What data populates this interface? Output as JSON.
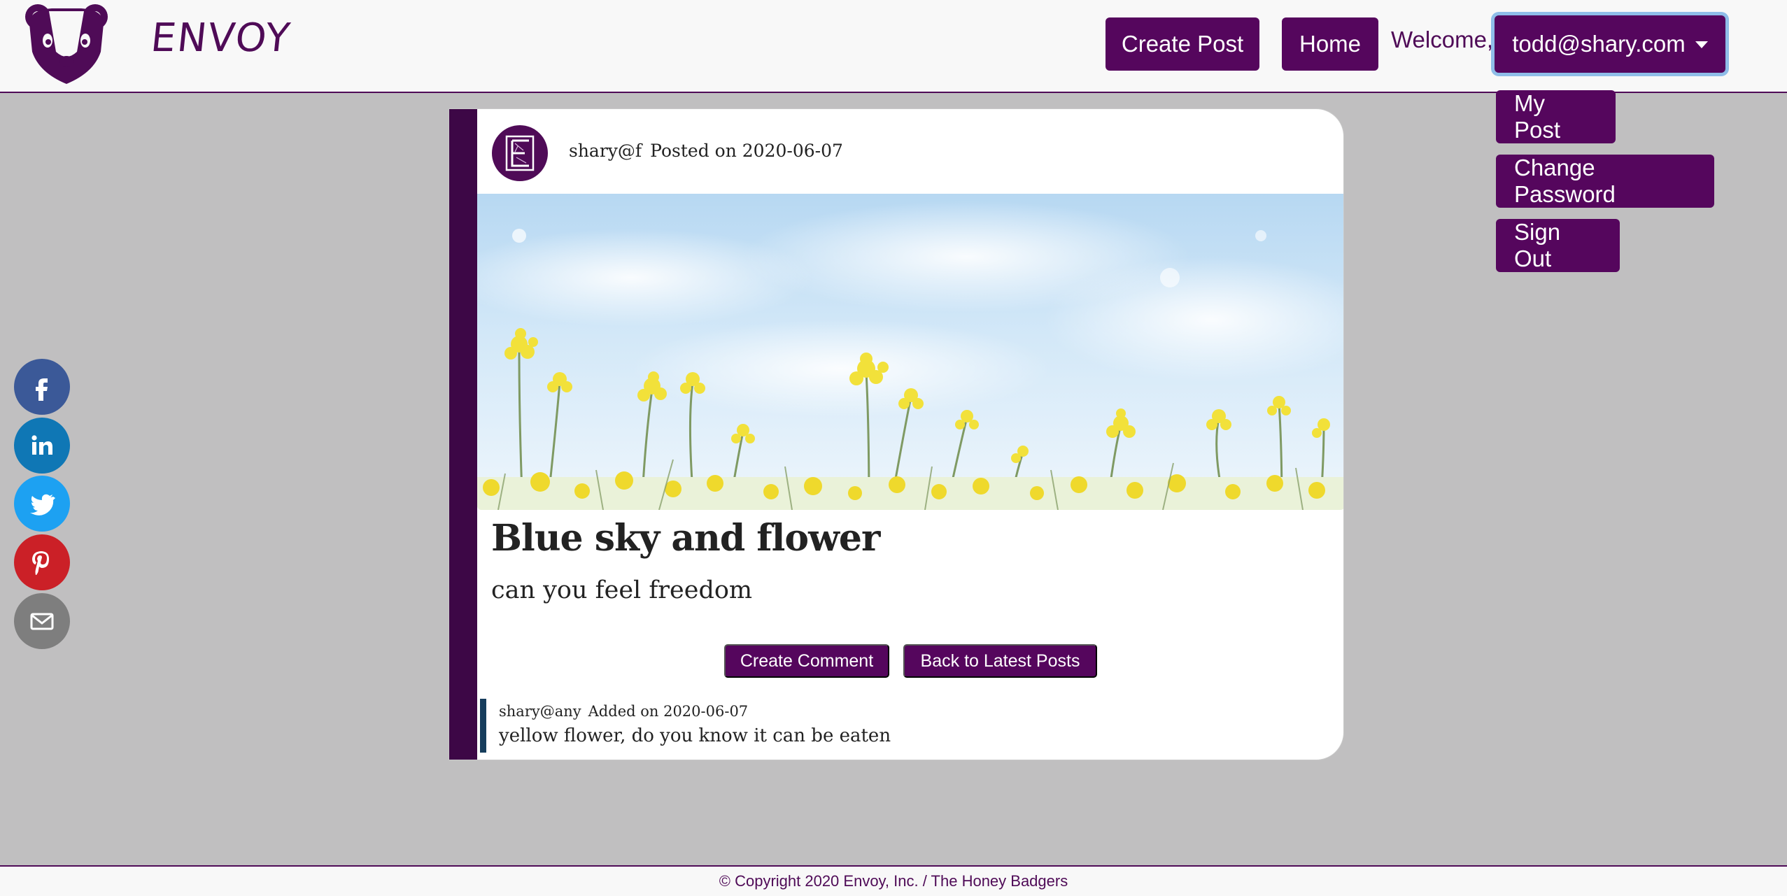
{
  "brand": {
    "name": "ENVOY"
  },
  "nav": {
    "create_post": "Create Post",
    "home": "Home",
    "welcome": "Welcome,",
    "user_email": "todd@shary.com",
    "dropdown": [
      "My Post",
      "Change Password",
      "Sign Out"
    ]
  },
  "social": [
    "facebook",
    "linkedin",
    "twitter",
    "pinterest",
    "email"
  ],
  "post": {
    "author": "shary@f",
    "posted_label": "Posted on 2020-06-07",
    "title": "Blue sky and flower",
    "body": "can you feel freedom",
    "create_comment": "Create Comment",
    "back": "Back to Latest Posts"
  },
  "comments": [
    {
      "author": "shary@any",
      "added": "Added on 2020-06-07",
      "text": "yellow flower, do you know it can be eaten"
    }
  ],
  "footer": {
    "copyright": "© Copyright 2020 Envoy, Inc. / The Honey Badgers"
  },
  "colors": {
    "primary": "#55065d",
    "accent_dark": "#3d0746",
    "comment_bar": "#163d5c",
    "focus_ring": "#8fbde8"
  }
}
